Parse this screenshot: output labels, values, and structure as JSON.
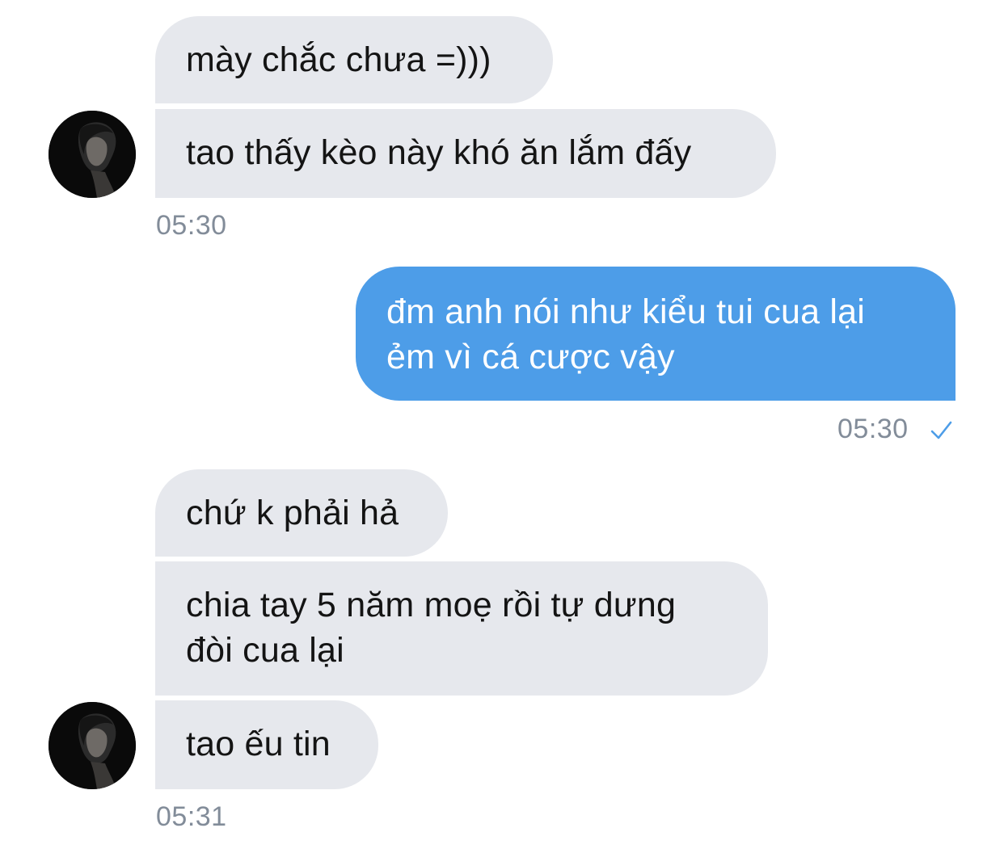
{
  "messages": [
    {
      "text": "mày chắc chưa =)))"
    },
    {
      "text": "tao thấy kèo này khó ăn lắm đấy"
    },
    {
      "time": "05:30"
    },
    {
      "text": "đm anh nói như kiểu tui cua lại ẻm vì cá cược vậy"
    },
    {
      "time": "05:30"
    },
    {
      "text": "chứ k phải hả"
    },
    {
      "text": "chia tay 5 năm moẹ rồi tự dưng đòi cua lại"
    },
    {
      "text": "tao ếu tin"
    },
    {
      "time": "05:31"
    }
  ],
  "group1": {
    "msg1": "mày chắc chưa =)))",
    "msg2": "tao thấy kèo này khó ăn lắm đấy",
    "time": "05:30"
  },
  "outgoing": {
    "line1": "đm anh nói như kiểu tui cua lại",
    "line2": "ẻm vì cá cược vậy",
    "time": "05:30",
    "status_icon": "check-icon",
    "accent_color": "#4d9de8"
  },
  "group2": {
    "msg1": "chứ k phải hả",
    "msg2_line1": "chia tay 5 năm moẹ rồi tự dưng",
    "msg2_line2": "đòi cua lại",
    "msg3": "tao ếu tin",
    "time": "05:31"
  },
  "colors": {
    "incoming_bubble": "#e6e8ed",
    "outgoing_bubble": "#4d9de8",
    "timestamp": "#828c99"
  }
}
